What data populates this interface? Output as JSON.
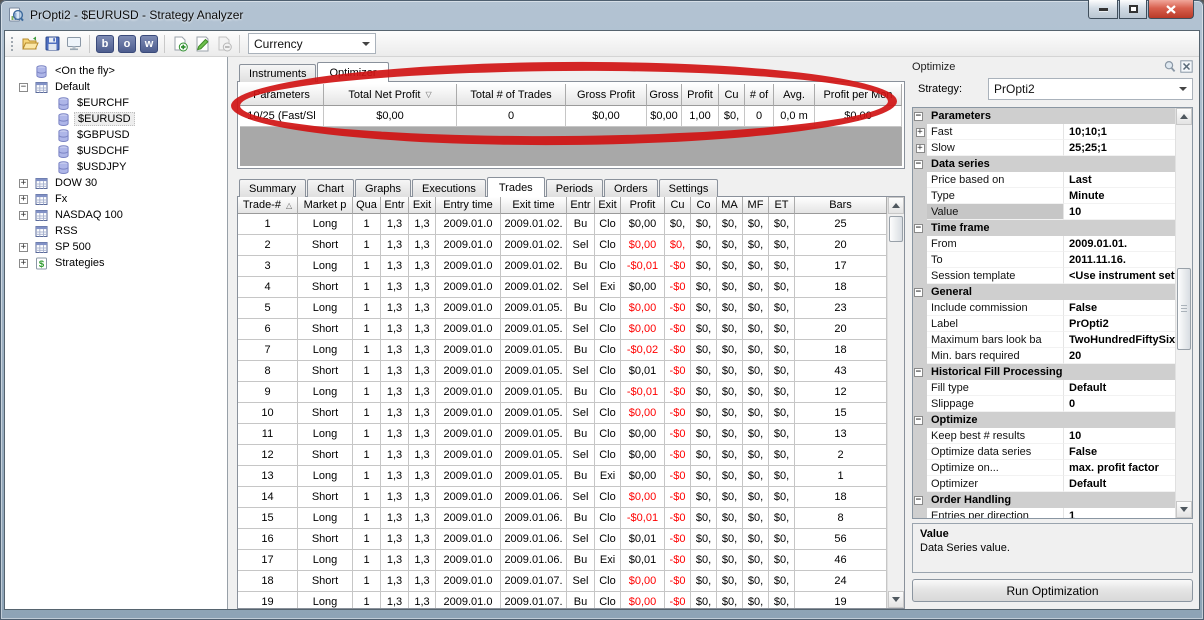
{
  "window": {
    "title": "PrOpti2 - $EURUSD - Strategy Analyzer"
  },
  "toolbar": {
    "letters": [
      "b",
      "o",
      "w"
    ],
    "instrument_selector": "Currency"
  },
  "sidebar": {
    "items": [
      {
        "label": "<On the fly>",
        "indent": 0,
        "expander": "none",
        "icon": "database",
        "selected": false
      },
      {
        "label": "Default",
        "indent": 0,
        "expander": "minus",
        "icon": "list",
        "selected": false
      },
      {
        "label": "$EURCHF",
        "indent": 1,
        "expander": "none",
        "icon": "database",
        "selected": false
      },
      {
        "label": "$EURUSD",
        "indent": 1,
        "expander": "none",
        "icon": "database",
        "selected": true
      },
      {
        "label": "$GBPUSD",
        "indent": 1,
        "expander": "none",
        "icon": "database",
        "selected": false
      },
      {
        "label": "$USDCHF",
        "indent": 1,
        "expander": "none",
        "icon": "database",
        "selected": false
      },
      {
        "label": "$USDJPY",
        "indent": 1,
        "expander": "none",
        "icon": "database",
        "selected": false
      },
      {
        "label": "DOW 30",
        "indent": 0,
        "expander": "plus",
        "icon": "list",
        "selected": false
      },
      {
        "label": "Fx",
        "indent": 0,
        "expander": "plus",
        "icon": "list",
        "selected": false
      },
      {
        "label": "NASDAQ 100",
        "indent": 0,
        "expander": "plus",
        "icon": "list",
        "selected": false
      },
      {
        "label": "RSS",
        "indent": 0,
        "expander": "none",
        "icon": "list",
        "selected": false
      },
      {
        "label": "SP 500",
        "indent": 0,
        "expander": "plus",
        "icon": "list",
        "selected": false
      },
      {
        "label": "Strategies",
        "indent": 0,
        "expander": "plus",
        "icon": "strategy",
        "selected": false
      }
    ]
  },
  "main": {
    "top_tabs": [
      {
        "label": "Instruments",
        "active": false
      },
      {
        "label": "Optimizer",
        "active": true
      }
    ],
    "optimizer_table": {
      "columns": [
        "Parameters",
        "Total Net Profit",
        "Total # of Trades",
        "Gross Profit",
        "Gross",
        "Profit",
        "Cu",
        "# of",
        "Avg.",
        "Profit per Mon"
      ],
      "sort_column_index": 1,
      "sort_glyph": "▽",
      "rows": [
        [
          "10/25 (Fast/Sl",
          "$0,00",
          "0",
          "$0,00",
          "$0,00",
          "1,00",
          "$0,",
          "0",
          "0,0 m",
          "$0,00"
        ]
      ]
    },
    "bottom_tabs": [
      {
        "label": "Summary",
        "active": false
      },
      {
        "label": "Chart",
        "active": false
      },
      {
        "label": "Graphs",
        "active": false
      },
      {
        "label": "Executions",
        "active": false
      },
      {
        "label": "Trades",
        "active": true
      },
      {
        "label": "Periods",
        "active": false
      },
      {
        "label": "Orders",
        "active": false
      },
      {
        "label": "Settings",
        "active": false
      }
    ],
    "trades_table": {
      "columns": [
        "Trade-#",
        "Market p",
        "Qua",
        "Entr",
        "Exit",
        "Entry time",
        "Exit time",
        "Entr",
        "Exit",
        "Profit",
        "Cu",
        "Co",
        "MA",
        "MF",
        "ET",
        "Bars"
      ],
      "sort_column_index": 0,
      "sort_glyph": "△",
      "rows": [
        {
          "c": [
            "1",
            "Long",
            "1",
            "1,3",
            "1,3",
            "2009.01.0",
            "2009.01.02.",
            "Bu",
            "Clo",
            "$0,00",
            "$0,",
            "$0,",
            "$0,",
            "$0,",
            "$0,",
            "25"
          ],
          "profit_red": false,
          "cum_red": false
        },
        {
          "c": [
            "2",
            "Short",
            "1",
            "1,3",
            "1,3",
            "2009.01.0",
            "2009.01.02.",
            "Sel",
            "Clo",
            "$0,00",
            "$0,",
            "$0,",
            "$0,",
            "$0,",
            "$0,",
            "20"
          ],
          "profit_red": true,
          "cum_red": true
        },
        {
          "c": [
            "3",
            "Long",
            "1",
            "1,3",
            "1,3",
            "2009.01.0",
            "2009.01.02.",
            "Bu",
            "Clo",
            "-$0,01",
            "-$0",
            "$0,",
            "$0,",
            "$0,",
            "$0,",
            "17"
          ],
          "profit_red": true,
          "cum_red": true
        },
        {
          "c": [
            "4",
            "Short",
            "1",
            "1,3",
            "1,3",
            "2009.01.0",
            "2009.01.02.",
            "Sel",
            "Exi",
            "$0,00",
            "-$0",
            "$0,",
            "$0,",
            "$0,",
            "$0,",
            "18"
          ],
          "profit_red": false,
          "cum_red": true
        },
        {
          "c": [
            "5",
            "Long",
            "1",
            "1,3",
            "1,3",
            "2009.01.0",
            "2009.01.05.",
            "Bu",
            "Clo",
            "$0,00",
            "-$0",
            "$0,",
            "$0,",
            "$0,",
            "$0,",
            "23"
          ],
          "profit_red": true,
          "cum_red": true
        },
        {
          "c": [
            "6",
            "Short",
            "1",
            "1,3",
            "1,3",
            "2009.01.0",
            "2009.01.05.",
            "Sel",
            "Clo",
            "$0,00",
            "-$0",
            "$0,",
            "$0,",
            "$0,",
            "$0,",
            "20"
          ],
          "profit_red": true,
          "cum_red": true
        },
        {
          "c": [
            "7",
            "Long",
            "1",
            "1,3",
            "1,3",
            "2009.01.0",
            "2009.01.05.",
            "Bu",
            "Clo",
            "-$0,02",
            "-$0",
            "$0,",
            "$0,",
            "$0,",
            "$0,",
            "18"
          ],
          "profit_red": true,
          "cum_red": true
        },
        {
          "c": [
            "8",
            "Short",
            "1",
            "1,3",
            "1,3",
            "2009.01.0",
            "2009.01.05.",
            "Sel",
            "Clo",
            "$0,01",
            "-$0",
            "$0,",
            "$0,",
            "$0,",
            "$0,",
            "43"
          ],
          "profit_red": false,
          "cum_red": true
        },
        {
          "c": [
            "9",
            "Long",
            "1",
            "1,3",
            "1,3",
            "2009.01.0",
            "2009.01.05.",
            "Bu",
            "Clo",
            "-$0,01",
            "-$0",
            "$0,",
            "$0,",
            "$0,",
            "$0,",
            "12"
          ],
          "profit_red": true,
          "cum_red": true
        },
        {
          "c": [
            "10",
            "Short",
            "1",
            "1,3",
            "1,3",
            "2009.01.0",
            "2009.01.05.",
            "Sel",
            "Clo",
            "$0,00",
            "-$0",
            "$0,",
            "$0,",
            "$0,",
            "$0,",
            "15"
          ],
          "profit_red": true,
          "cum_red": true
        },
        {
          "c": [
            "11",
            "Long",
            "1",
            "1,3",
            "1,3",
            "2009.01.0",
            "2009.01.05.",
            "Bu",
            "Clo",
            "$0,00",
            "-$0",
            "$0,",
            "$0,",
            "$0,",
            "$0,",
            "13"
          ],
          "profit_red": false,
          "cum_red": true
        },
        {
          "c": [
            "12",
            "Short",
            "1",
            "1,3",
            "1,3",
            "2009.01.0",
            "2009.01.05.",
            "Sel",
            "Clo",
            "$0,00",
            "-$0",
            "$0,",
            "$0,",
            "$0,",
            "$0,",
            "2"
          ],
          "profit_red": false,
          "cum_red": true
        },
        {
          "c": [
            "13",
            "Long",
            "1",
            "1,3",
            "1,3",
            "2009.01.0",
            "2009.01.05.",
            "Bu",
            "Exi",
            "$0,00",
            "-$0",
            "$0,",
            "$0,",
            "$0,",
            "$0,",
            "1"
          ],
          "profit_red": false,
          "cum_red": true
        },
        {
          "c": [
            "14",
            "Short",
            "1",
            "1,3",
            "1,3",
            "2009.01.0",
            "2009.01.06.",
            "Sel",
            "Clo",
            "$0,00",
            "-$0",
            "$0,",
            "$0,",
            "$0,",
            "$0,",
            "18"
          ],
          "profit_red": true,
          "cum_red": true
        },
        {
          "c": [
            "15",
            "Long",
            "1",
            "1,3",
            "1,3",
            "2009.01.0",
            "2009.01.06.",
            "Bu",
            "Clo",
            "-$0,01",
            "-$0",
            "$0,",
            "$0,",
            "$0,",
            "$0,",
            "8"
          ],
          "profit_red": true,
          "cum_red": true
        },
        {
          "c": [
            "16",
            "Short",
            "1",
            "1,3",
            "1,3",
            "2009.01.0",
            "2009.01.06.",
            "Sel",
            "Clo",
            "$0,01",
            "-$0",
            "$0,",
            "$0,",
            "$0,",
            "$0,",
            "56"
          ],
          "profit_red": false,
          "cum_red": true
        },
        {
          "c": [
            "17",
            "Long",
            "1",
            "1,3",
            "1,3",
            "2009.01.0",
            "2009.01.06.",
            "Bu",
            "Exi",
            "$0,01",
            "-$0",
            "$0,",
            "$0,",
            "$0,",
            "$0,",
            "46"
          ],
          "profit_red": false,
          "cum_red": true
        },
        {
          "c": [
            "18",
            "Short",
            "1",
            "1,3",
            "1,3",
            "2009.01.0",
            "2009.01.07.",
            "Sel",
            "Clo",
            "$0,00",
            "-$0",
            "$0,",
            "$0,",
            "$0,",
            "$0,",
            "24"
          ],
          "profit_red": true,
          "cum_red": true
        },
        {
          "c": [
            "19",
            "Long",
            "1",
            "1,3",
            "1,3",
            "2009.01.0",
            "2009.01.07.",
            "Bu",
            "Clo",
            "$0,00",
            "-$0",
            "$0,",
            "$0,",
            "$0,",
            "$0,",
            "19"
          ],
          "profit_red": true,
          "cum_red": true
        }
      ]
    }
  },
  "optimize_panel": {
    "title": "Optimize",
    "strategy_label": "Strategy:",
    "strategy_value": "PrOpti2",
    "sections": [
      {
        "title": "Parameters",
        "rows": [
          {
            "label": "Fast",
            "value": "10;10;1",
            "expandable": true
          },
          {
            "label": "Slow",
            "value": "25;25;1",
            "expandable": true
          }
        ]
      },
      {
        "title": "Data series",
        "rows": [
          {
            "label": "Price based on",
            "value": "Last"
          },
          {
            "label": "Type",
            "value": "Minute"
          },
          {
            "label": "Value",
            "value": "10",
            "selected": true
          }
        ]
      },
      {
        "title": "Time frame",
        "rows": [
          {
            "label": "From",
            "value": "2009.01.01."
          },
          {
            "label": "To",
            "value": "2011.11.16."
          },
          {
            "label": "Session template",
            "value": "<Use instrument setting"
          }
        ]
      },
      {
        "title": "General",
        "rows": [
          {
            "label": "Include commission",
            "value": "False"
          },
          {
            "label": "Label",
            "value": "PrOpti2"
          },
          {
            "label": "Maximum bars look ba",
            "value": "TwoHundredFiftySix"
          },
          {
            "label": "Min. bars required",
            "value": "20"
          }
        ]
      },
      {
        "title": "Historical Fill Processing",
        "rows": [
          {
            "label": "Fill type",
            "value": "Default"
          },
          {
            "label": "Slippage",
            "value": "0"
          }
        ]
      },
      {
        "title": "Optimize",
        "rows": [
          {
            "label": "Keep best # results",
            "value": "10"
          },
          {
            "label": "Optimize data series",
            "value": "False"
          },
          {
            "label": "Optimize on...",
            "value": "max. profit factor"
          },
          {
            "label": "Optimizer",
            "value": "Default"
          }
        ]
      },
      {
        "title": "Order Handling",
        "rows": [
          {
            "label": "Entries per direction",
            "value": "1"
          }
        ]
      }
    ],
    "description": {
      "title": "Value",
      "text": "Data Series value."
    },
    "run_button": "Run Optimization"
  },
  "annotation": {
    "shape": "ellipse",
    "color": "#d01414"
  }
}
